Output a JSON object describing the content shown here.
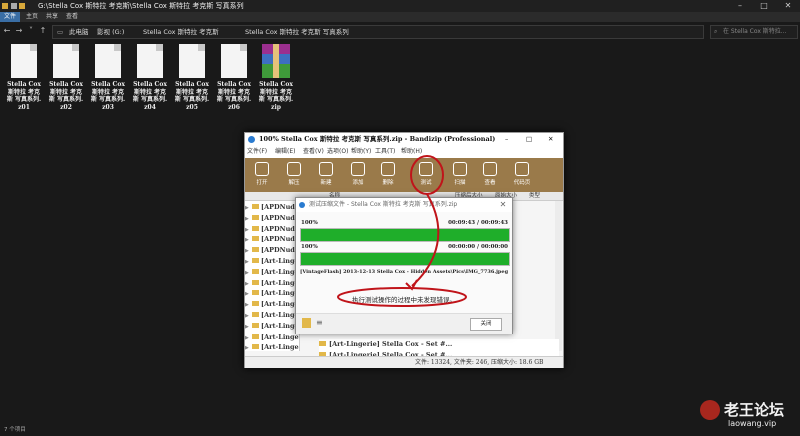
{
  "explorer": {
    "title": "G:\\Stella Cox 斯特拉 考克斯\\Stella Cox 斯特拉 考克斯 写真系列",
    "tabs": [
      "文件",
      "主页",
      "共享",
      "查看"
    ],
    "breadcrumb": [
      "此电脑",
      "影视 (G:)",
      "Stella Cox 斯特拉 考克斯",
      "Stella Cox 斯特拉 考克斯 写真系列"
    ],
    "search_placeholder": "在 Stella Cox 斯特拉...",
    "files": [
      {
        "l1": "Stella Cox",
        "l2": "斯特拉 考克",
        "l3": "斯 写真系列.",
        "l4": "z01"
      },
      {
        "l1": "Stella Cox",
        "l2": "斯特拉 考克",
        "l3": "斯 写真系列.",
        "l4": "z02"
      },
      {
        "l1": "Stella Cox",
        "l2": "斯特拉 考克",
        "l3": "斯 写真系列.",
        "l4": "z03"
      },
      {
        "l1": "Stella Cox",
        "l2": "斯特拉 考克",
        "l3": "斯 写真系列.",
        "l4": "z04"
      },
      {
        "l1": "Stella Cox",
        "l2": "斯特拉 考克",
        "l3": "斯 写真系列.",
        "l4": "z05"
      },
      {
        "l1": "Stella Cox",
        "l2": "斯特拉 考克",
        "l3": "斯 写真系列.",
        "l4": "z06"
      },
      {
        "l1": "Stella Cox",
        "l2": "斯特拉 考克",
        "l3": "斯 写真系列.",
        "l4": "zip"
      }
    ],
    "status": "7 个项目"
  },
  "bandizip": {
    "title": "100% Stella Cox 斯特拉 考克斯 写真系列.zip - Bandizip (Professional)",
    "menu": [
      "文件(F)",
      "编辑(E)",
      "查看(V)",
      "选项(O)",
      "帮助(Y)",
      "工具(T)",
      "帮助(H)"
    ],
    "toolbar": [
      "打开",
      "解压",
      "新建",
      "添加",
      "删除",
      "测试",
      "扫描",
      "查看",
      "代码页"
    ],
    "columns": [
      "名称",
      "压缩后大小",
      "原始大小",
      "类型"
    ],
    "tree": [
      "[APDNude",
      "[APDNude",
      "[APDNude",
      "[APDNude",
      "[APDNude",
      "[Art-Linge",
      "[Art-Linge",
      "[Art-Linge",
      "[Art-Linge",
      "[Art-Linge",
      "[Art-Linge",
      "[Art-Linge",
      "[Art-Linge",
      "[Art-Linge"
    ],
    "lower_rows": [
      "[Art-Lingerie] Stella Cox - Set #...",
      "[Art-Lingerie] Stella Cox - Set #..."
    ],
    "status": "文件: 13324, 文件夹: 246, 压缩大小: 18.6 GB"
  },
  "dialog": {
    "title": "测试压缩文件 - Stella Cox 斯特拉 考克斯 写真系列.zip",
    "top_pct": "100%",
    "top_time": "00:09:43 / 00:09:43",
    "top_progress": 100,
    "bottom_pct": "100%",
    "bottom_time": "00:00:00 / 00:00:00",
    "bottom_progress": 100,
    "file": "[VintageFlash] 2013-12-13 Stella Cox - Hidden Assets\\Pics\\IMG_7736.jpeg",
    "message": "执行测试操作的过程中未发现错误。",
    "ok_label": "关闭"
  },
  "watermark": {
    "cn": "老王论坛",
    "url": "laowang.vip"
  },
  "colors": {
    "bar_green": "#1fae2a",
    "toolbar_brown": "#9a7a4a",
    "annotation_red": "#c0141a"
  }
}
